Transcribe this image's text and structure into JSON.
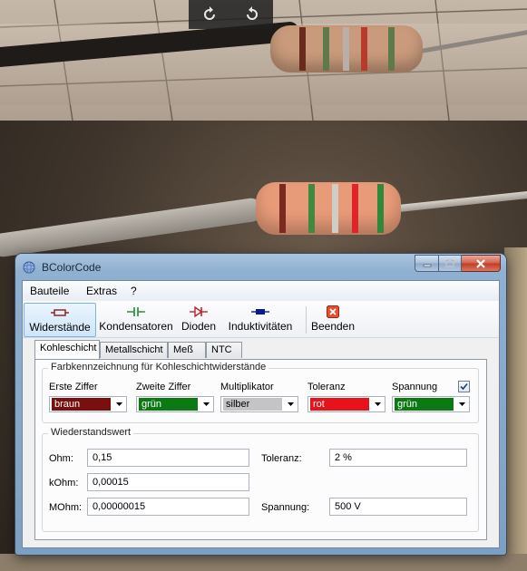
{
  "viewer": {
    "rotate_left_label": "rotate-left",
    "rotate_right_label": "rotate-right"
  },
  "window": {
    "title": "BColorCode"
  },
  "menu": [
    "Bauteile",
    "Extras",
    "?"
  ],
  "toolbar": {
    "items": [
      {
        "label": "Widerstände",
        "icon": "resistor-icon",
        "selected": true
      },
      {
        "label": "Kondensatoren",
        "icon": "capacitor-icon",
        "selected": false
      },
      {
        "label": "Dioden",
        "icon": "diode-icon",
        "selected": false
      },
      {
        "label": "Induktivitäten",
        "icon": "inductor-icon",
        "selected": false
      }
    ],
    "exit_label": "Beenden"
  },
  "tabs": [
    "Kohleschicht",
    "Metallschicht",
    "Meß",
    "NTC"
  ],
  "active_tab": "Kohleschicht",
  "color_group": {
    "title": "Farbkennzeichnung für Kohleschichtwiderstände",
    "columns": [
      {
        "label": "Erste Ziffer",
        "value": "braun",
        "color": "#7a0f0f",
        "text_color": "#ffffff"
      },
      {
        "label": "Zweite Ziffer",
        "value": "grün",
        "color": "#0b7a13",
        "text_color": "#ffffff"
      },
      {
        "label": "Multiplikator",
        "value": "silber",
        "color": "#c4c4c4",
        "text_color": "#000000"
      },
      {
        "label": "Toleranz",
        "value": "rot",
        "color": "#e8121a",
        "text_color": "#ffffff"
      },
      {
        "label": "Spannung",
        "value": "grün",
        "color": "#0b7a13",
        "text_color": "#ffffff"
      }
    ],
    "voltage_checked": true
  },
  "value_group": {
    "title": "Wiederstandswert",
    "ohm_label": "Ohm:",
    "ohm_value": "0,15",
    "kohm_label": "kOhm:",
    "kohm_value": "0,00015",
    "mohm_label": "MOhm:",
    "mohm_value": "0,00000015",
    "tolerance_label": "Toleranz:",
    "tolerance_value": "2 %",
    "voltage_label": "Spannung:",
    "voltage_value": "500 V"
  }
}
